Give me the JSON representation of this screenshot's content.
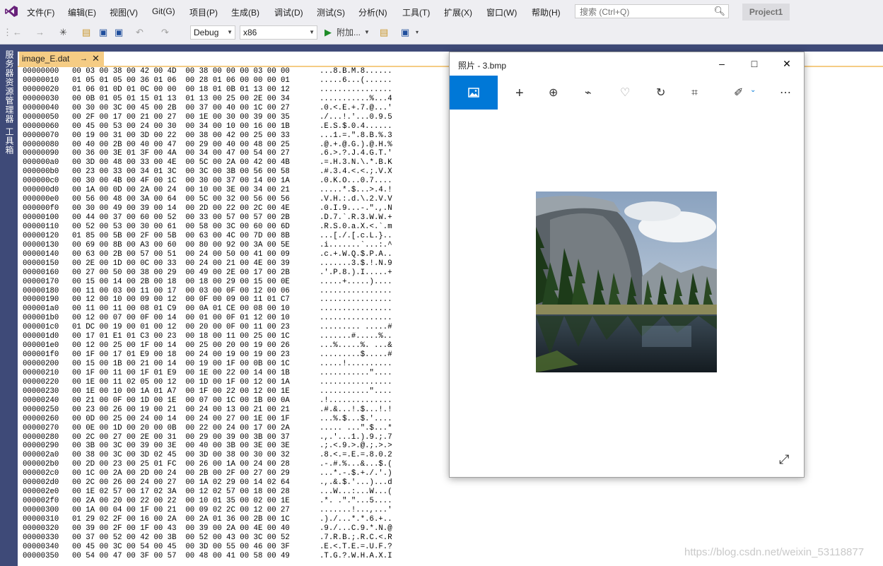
{
  "menu": {
    "items": [
      "文件(F)",
      "编辑(E)",
      "视图(V)",
      "Git(G)",
      "项目(P)",
      "生成(B)",
      "调试(D)",
      "测试(S)",
      "分析(N)",
      "工具(T)",
      "扩展(X)",
      "窗口(W)",
      "帮助(H)"
    ],
    "search_placeholder": "搜索 (Ctrl+Q)",
    "project_name": "Project1"
  },
  "toolbar": {
    "configuration": "Debug",
    "platform": "x86",
    "attach_label": "附加..."
  },
  "side_panel": {
    "labels": [
      "服务器资源管理器",
      "工具箱"
    ]
  },
  "editor": {
    "tab_name": "image_E.dat",
    "hex_rows": [
      {
        "offset": "00000000",
        "bytes": "00 03 00 38 00 42 00 4D  00 38 00 00 00 03 00 00",
        "ascii": "...8.B.M.8......"
      },
      {
        "offset": "00000010",
        "bytes": "01 05 01 05 00 36 01 06  00 28 01 06 00 00 00 01",
        "ascii": ".....6...(......"
      },
      {
        "offset": "00000020",
        "bytes": "01 06 01 0D 01 0C 00 00  00 18 01 0B 01 13 00 12",
        "ascii": "................"
      },
      {
        "offset": "00000030",
        "bytes": "00 0B 01 05 01 15 01 13  01 13 00 25 00 2E 00 34",
        "ascii": "...........%...4"
      },
      {
        "offset": "00000040",
        "bytes": "00 30 00 3C 00 45 00 2B  00 37 00 40 00 1C 00 27",
        "ascii": ".0.<.E.+.7.@...'"
      },
      {
        "offset": "00000050",
        "bytes": "00 2F 00 17 00 21 00 27  00 1E 00 30 00 39 00 35",
        "ascii": "./...!.'...0.9.5"
      },
      {
        "offset": "00000060",
        "bytes": "00 45 00 53 00 24 00 30  00 34 00 10 00 16 00 1B",
        "ascii": ".E.S.$.0.4......"
      },
      {
        "offset": "00000070",
        "bytes": "00 19 00 31 00 3D 00 22  00 38 00 42 00 25 00 33",
        "ascii": "...1.=.\".8.B.%.3"
      },
      {
        "offset": "00000080",
        "bytes": "00 40 00 2B 00 40 00 47  00 29 00 40 00 48 00 25",
        "ascii": ".@.+.@.G.).@.H.%"
      },
      {
        "offset": "00000090",
        "bytes": "00 36 00 3E 01 3F 00 4A  00 34 00 47 00 54 00 27",
        "ascii": ".6.>.?.J.4.G.T.'"
      },
      {
        "offset": "000000a0",
        "bytes": "00 3D 00 48 00 33 00 4E  00 5C 00 2A 00 42 00 4B",
        "ascii": ".=.H.3.N.\\.*.B.K"
      },
      {
        "offset": "000000b0",
        "bytes": "00 23 00 33 00 34 01 3C  00 3C 00 3B 00 56 00 58",
        "ascii": ".#.3.4.<.<.;.V.X"
      },
      {
        "offset": "000000c0",
        "bytes": "00 30 00 4B 00 4F 00 1C  00 30 00 37 00 14 00 1A",
        "ascii": ".0.K.O...0.7...."
      },
      {
        "offset": "000000d0",
        "bytes": "00 1A 00 0D 00 2A 00 24  00 10 00 3E 00 34 00 21",
        "ascii": ".....*.$...>.4.!"
      },
      {
        "offset": "000000e0",
        "bytes": "00 56 00 48 00 3A 00 64  00 5C 00 32 00 56 00 56",
        "ascii": ".V.H.:.d.\\.2.V.V"
      },
      {
        "offset": "000000f0",
        "bytes": "00 30 00 49 00 39 00 14  00 2D 00 22 00 2C 00 4E",
        "ascii": ".0.I.9...-.\".,.N"
      },
      {
        "offset": "00000100",
        "bytes": "00 44 00 37 00 60 00 52  00 33 00 57 00 57 00 2B",
        "ascii": ".D.7.`.R.3.W.W.+"
      },
      {
        "offset": "00000110",
        "bytes": "00 52 00 53 00 30 00 61  00 58 00 3C 00 60 00 6D",
        "ascii": ".R.S.0.a.X.<.`.m"
      },
      {
        "offset": "00000120",
        "bytes": "01 85 00 5B 00 2F 00 5B  00 63 00 4C 00 7D 00 8B",
        "ascii": "...[./.[.c.L.}.."
      },
      {
        "offset": "00000130",
        "bytes": "00 69 00 8B 00 A3 00 60  00 80 00 92 00 3A 00 5E",
        "ascii": ".i.......`...:.^"
      },
      {
        "offset": "00000140",
        "bytes": "00 63 00 2B 00 57 00 51  00 24 00 50 00 41 00 09",
        "ascii": ".c.+.W.Q.$.P.A.."
      },
      {
        "offset": "00000150",
        "bytes": "00 2E 00 1D 00 0C 00 33  00 24 00 21 00 4E 00 39",
        "ascii": ".......3.$.!.N.9"
      },
      {
        "offset": "00000160",
        "bytes": "00 27 00 50 00 38 00 29  00 49 00 2E 00 17 00 2B",
        "ascii": ".'.P.8.).I.....+"
      },
      {
        "offset": "00000170",
        "bytes": "00 15 00 14 00 2B 00 18  00 18 00 29 00 15 00 0E",
        "ascii": ".....+.....)...."
      },
      {
        "offset": "00000180",
        "bytes": "00 11 00 03 00 11 00 17  00 03 00 0F 00 12 00 06",
        "ascii": "................"
      },
      {
        "offset": "00000190",
        "bytes": "00 12 00 10 00 09 00 12  00 0F 00 09 00 11 01 C7",
        "ascii": "................"
      },
      {
        "offset": "000001a0",
        "bytes": "00 11 00 11 00 08 01 C9  00 0A 01 CE 00 08 00 10",
        "ascii": "................"
      },
      {
        "offset": "000001b0",
        "bytes": "00 12 00 07 00 0F 00 14  00 01 00 0F 01 12 00 10",
        "ascii": "................"
      },
      {
        "offset": "000001c0",
        "bytes": "01 DC 00 19 00 01 00 12  00 20 00 0F 00 11 00 23",
        "ascii": "......... .....#"
      },
      {
        "offset": "000001d0",
        "bytes": "00 17 01 E1 01 C3 00 23  00 18 00 11 00 25 00 1C",
        "ascii": ".......#.....%.."
      },
      {
        "offset": "000001e0",
        "bytes": "00 12 00 25 00 1F 00 14  00 25 00 20 00 19 00 26",
        "ascii": "...%.....%. ...&"
      },
      {
        "offset": "000001f0",
        "bytes": "00 1F 00 17 01 E9 00 18  00 24 00 19 00 19 00 23",
        "ascii": ".........$.....#"
      },
      {
        "offset": "00000200",
        "bytes": "00 15 00 1B 00 21 00 14  00 19 00 1F 00 0B 00 1C",
        "ascii": ".....!.........."
      },
      {
        "offset": "00000210",
        "bytes": "00 1F 00 11 00 1F 01 E9  00 1E 00 22 00 14 00 1B",
        "ascii": "...........\"...."
      },
      {
        "offset": "00000220",
        "bytes": "00 1E 00 11 02 05 00 12  00 1D 00 1F 00 12 00 1A",
        "ascii": "................"
      },
      {
        "offset": "00000230",
        "bytes": "00 1E 00 10 00 1A 01 A7  00 1F 00 22 00 12 00 1E",
        "ascii": "...........\"...."
      },
      {
        "offset": "00000240",
        "bytes": "00 21 00 0F 00 1D 00 1E  00 07 00 1C 00 1B 00 0A",
        "ascii": ".!.............."
      },
      {
        "offset": "00000250",
        "bytes": "00 23 00 26 00 19 00 21  00 24 00 13 00 21 00 21",
        "ascii": ".#.&...!.$...!.!"
      },
      {
        "offset": "00000260",
        "bytes": "00 0D 00 25 00 24 00 14  00 24 00 27 00 1E 00 1F",
        "ascii": "...%.$...$.'...."
      },
      {
        "offset": "00000270",
        "bytes": "00 0E 00 1D 00 20 00 0B  00 22 00 24 00 17 00 2A",
        "ascii": "..... ...\".$...*"
      },
      {
        "offset": "00000280",
        "bytes": "00 2C 00 27 00 2E 00 31  00 29 00 39 00 3B 00 37",
        "ascii": ".,.'...1.).9.;.7"
      },
      {
        "offset": "00000290",
        "bytes": "00 3B 00 3C 00 39 00 3E  00 40 00 3B 00 3E 00 3E",
        "ascii": ".;.<.9.>.@.;.>.>"
      },
      {
        "offset": "000002a0",
        "bytes": "00 38 00 3C 00 3D 02 45  00 3D 00 38 00 30 00 32",
        "ascii": ".8.<.=.E.=.8.0.2"
      },
      {
        "offset": "000002b0",
        "bytes": "00 2D 00 23 00 25 01 FC  00 26 00 1A 00 24 00 28",
        "ascii": ".-.#.%...&...$.("
      },
      {
        "offset": "000002c0",
        "bytes": "00 1C 00 2A 00 2D 00 24  00 2B 00 2F 00 27 00 29",
        "ascii": "...*.-.$.+./.'.)"
      },
      {
        "offset": "000002d0",
        "bytes": "00 2C 00 26 00 24 00 27  00 1A 02 29 00 14 02 64",
        "ascii": ".,.&.$.'...)...d"
      },
      {
        "offset": "000002e0",
        "bytes": "00 1E 02 57 00 17 02 3A  00 12 02 57 00 18 00 28",
        "ascii": "...W...:...W...("
      },
      {
        "offset": "000002f0",
        "bytes": "00 2A 00 20 00 22 00 22  00 10 01 35 00 02 00 1E",
        "ascii": ".*. .\".\"...5...."
      },
      {
        "offset": "00000300",
        "bytes": "00 1A 00 04 00 1F 00 21  00 09 02 2C 00 12 00 27",
        "ascii": ".......!...,...'"
      },
      {
        "offset": "00000310",
        "bytes": "01 29 02 2F 00 16 00 2A  00 2A 01 36 00 2B 00 1C",
        "ascii": ".)./...*.*.6.+.."
      },
      {
        "offset": "00000320",
        "bytes": "00 39 00 2F 00 1F 00 43  00 39 00 2A 00 4E 00 40",
        "ascii": ".9./...C.9.*.N.@"
      },
      {
        "offset": "00000330",
        "bytes": "00 37 00 52 00 42 00 3B  00 52 00 43 00 3C 00 52",
        "ascii": ".7.R.B.;.R.C.<.R"
      },
      {
        "offset": "00000340",
        "bytes": "00 45 00 3C 00 54 00 45  00 3D 00 55 00 46 00 3F",
        "ascii": ".E.<.T.E.=.U.F.?"
      },
      {
        "offset": "00000350",
        "bytes": "00 54 00 47 00 3F 00 57  00 48 00 41 00 58 00 49",
        "ascii": ".T.G.?.W.H.A.X.I"
      }
    ]
  },
  "photos_window": {
    "title": "照片 - 3.bmp",
    "tools": [
      "add-icon",
      "zoom-in-icon",
      "delete-icon",
      "favorite-icon",
      "rotate-icon",
      "crop-icon",
      "edit-icon",
      "more-icon"
    ]
  },
  "watermark": "https://blog.csdn.net/weixin_53118877",
  "colors": {
    "chrome_bg": "#eeeef2",
    "side_strip": "#3e4a78",
    "tab_active": "#f5cc84",
    "photos_accent": "#0078d7"
  }
}
